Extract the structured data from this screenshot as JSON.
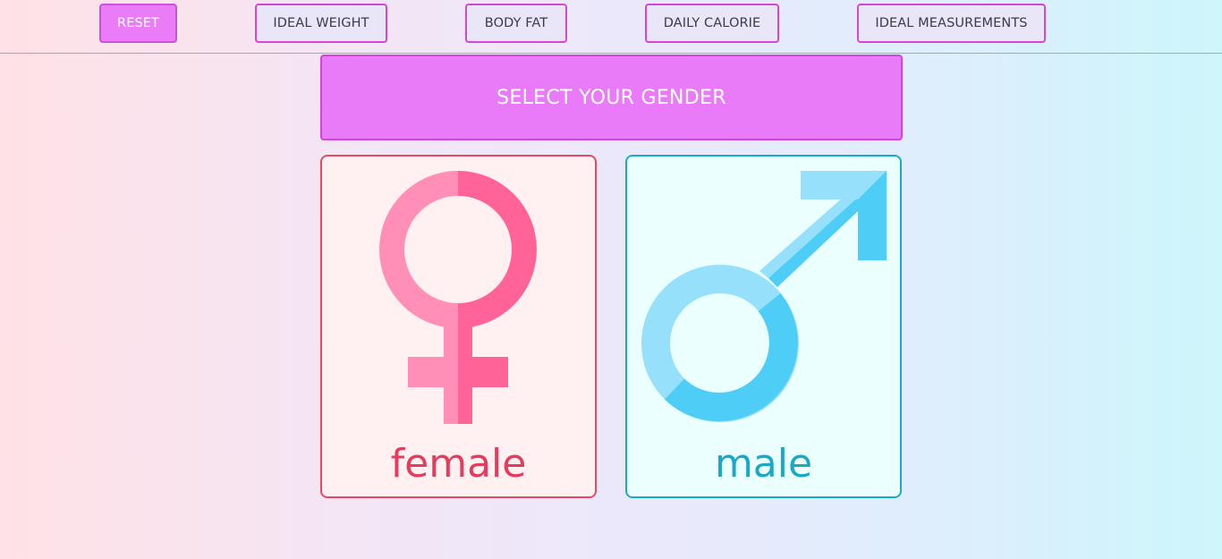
{
  "nav": {
    "buttons": [
      {
        "label": "RESET",
        "active": true
      },
      {
        "label": "IDEAL WEIGHT",
        "active": false
      },
      {
        "label": "BODY FAT",
        "active": false
      },
      {
        "label": "DAILY CALORIE",
        "active": false
      },
      {
        "label": "IDEAL MEASUREMENTS",
        "active": false
      }
    ]
  },
  "banner": {
    "title": "SELECT YOUR GENDER"
  },
  "genders": {
    "female": {
      "label": "female",
      "icon": "female-symbol-icon",
      "color": "#e33c5c"
    },
    "male": {
      "label": "male",
      "icon": "male-symbol-icon",
      "color": "#1aa8c5"
    }
  },
  "colors": {
    "accent": "#e97bf8",
    "female_light": "#ff8fb7",
    "female_dark": "#ff6397",
    "male_light": "#97e0fc",
    "male_dark": "#4ecdf7"
  }
}
